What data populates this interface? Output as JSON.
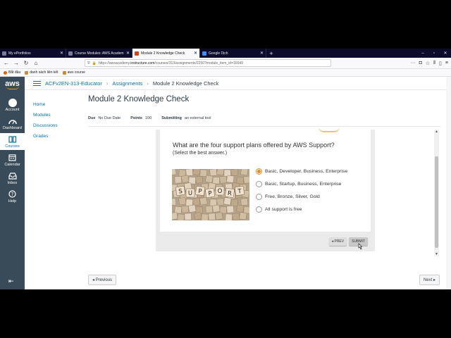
{
  "browser": {
    "tabs": [
      {
        "title": "My ePortfolios",
        "active": false
      },
      {
        "title": "Course Modules: AWS Academ",
        "active": false
      },
      {
        "title": "Module 2 Knowledge Check",
        "active": true
      },
      {
        "title": "Google Dịch",
        "active": false
      }
    ],
    "new_tab": "+",
    "win_controls": [
      "–",
      "▫",
      "✕"
    ],
    "url_prefix": "https://awsacademy.",
    "url_domain": "instructure.com",
    "url_path": "/courses/313/assignments/2250?module_item_id=16649",
    "bookmarks": [
      "Bắt đầu",
      "danh sách liên kết",
      "aws course"
    ]
  },
  "global_nav": {
    "logo": "aws",
    "items": [
      {
        "label": "Account",
        "icon": "account-icon",
        "active": false
      },
      {
        "label": "Dashboard",
        "icon": "dashboard-icon",
        "active": false
      },
      {
        "label": "Courses",
        "icon": "courses-icon",
        "active": true
      },
      {
        "label": "Calendar",
        "icon": "calendar-icon",
        "active": false
      },
      {
        "label": "Inbox",
        "icon": "inbox-icon",
        "active": false
      },
      {
        "label": "Help",
        "icon": "help-icon",
        "active": false
      }
    ]
  },
  "breadcrumb": {
    "course": "ACFv2EN-313-Educator",
    "section": "Assignments",
    "current": "Module 2 Knowledge Check",
    "sep": "›"
  },
  "course_nav": [
    "Home",
    "Modules",
    "Discussions",
    "Grades"
  ],
  "assignment": {
    "title": "Module 2 Knowledge Check",
    "due_label": "Due",
    "due_value": "No Due Date",
    "points_label": "Points",
    "points_value": "100",
    "submitting_label": "Submitting",
    "submitting_value": "an external tool"
  },
  "quiz": {
    "question": "What are the four support plans offered by AWS Support?",
    "instruction": "(Select the best answer.)",
    "image_word": [
      "S",
      "U",
      "P",
      "P",
      "O",
      "R",
      "T"
    ],
    "options": [
      {
        "label": "Basic, Developer, Business, Enterprise",
        "selected": true
      },
      {
        "label": "Basic, Startup, Business, Enterprise",
        "selected": false
      },
      {
        "label": "Free, Bronze, Silver, Gold",
        "selected": false
      },
      {
        "label": "All support is free",
        "selected": false
      }
    ],
    "prev_label": "PREV",
    "submit_label": "SUBMIT",
    "accent_color": "#e8891f"
  },
  "pagination": {
    "previous": "Previous",
    "next": "Next"
  }
}
